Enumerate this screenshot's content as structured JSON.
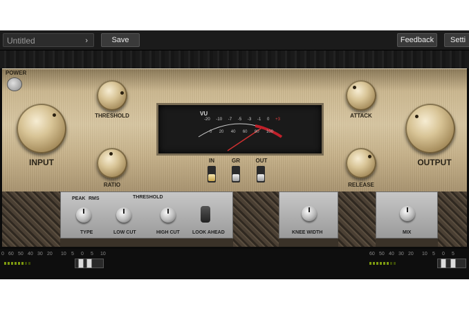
{
  "toolbar": {
    "preset_name": "Untitled",
    "save_label": "Save",
    "feedback_label": "Feedback",
    "settings_label": "Setti"
  },
  "panel": {
    "power_label": "POWER",
    "input_label": "INPUT",
    "output_label": "OUTPUT",
    "threshold_label": "THRESHOLD",
    "ratio_label": "RATIO",
    "attack_label": "ATTACK",
    "release_label": "RELEASE",
    "switches": {
      "in": "IN",
      "gr": "GR",
      "out": "OUT"
    }
  },
  "vu_meter": {
    "label": "VU",
    "scale": [
      "-20",
      "-10",
      "-7",
      "-5",
      "-3",
      "-1",
      "0",
      "+3"
    ],
    "scale_lower": [
      "0",
      "20",
      "40",
      "60",
      "80",
      "100"
    ]
  },
  "sidechain": {
    "peak_label": "PEAK",
    "rms_label": "RMS",
    "threshold_label": "THRESHOLD",
    "type_label": "TYPE",
    "low_cut_label": "LOW CUT",
    "high_cut_label": "HIGH CUT",
    "look_ahead_label": "LOOK AHEAD",
    "knee_width_label": "KNEE WIDTH",
    "mix_label": "MIX"
  },
  "meter_scale": [
    "0",
    "60",
    "50",
    "40",
    "30",
    "20",
    "10",
    "5",
    "0",
    "5",
    "10"
  ],
  "colors": {
    "panel_gold": "#cdb991",
    "led_green": "#7d9a10",
    "needle_red": "#c0202a"
  }
}
